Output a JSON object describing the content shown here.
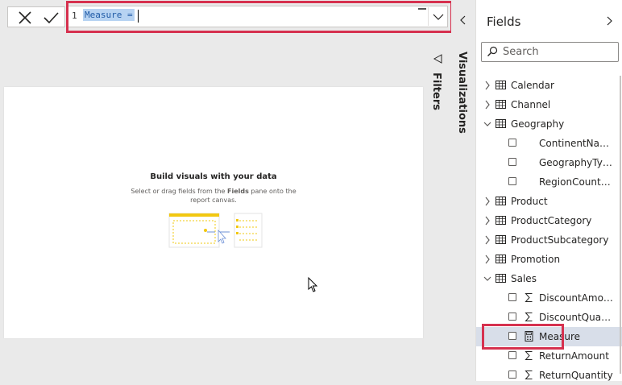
{
  "formula_bar": {
    "line_number": "1",
    "expression": "Measure = "
  },
  "canvas": {
    "empty_title": "Build visuals with your data",
    "empty_subtitle_before": "Select or drag fields from the ",
    "empty_subtitle_bold": "Fields",
    "empty_subtitle_after": " pane onto the report canvas."
  },
  "panes": {
    "filters_label": "Filters",
    "visualizations_label": "Visualizations",
    "fields_title": "Fields"
  },
  "search": {
    "placeholder": "Search"
  },
  "fields": [
    {
      "type": "table",
      "label": "Calendar",
      "expanded": false
    },
    {
      "type": "table",
      "label": "Channel",
      "expanded": false
    },
    {
      "type": "table",
      "label": "Geography",
      "expanded": true
    },
    {
      "type": "field",
      "label": "ContinentName",
      "icon": "none"
    },
    {
      "type": "field",
      "label": "GeographyType",
      "icon": "none"
    },
    {
      "type": "field",
      "label": "RegionCountry...",
      "icon": "none"
    },
    {
      "type": "table",
      "label": "Product",
      "expanded": false
    },
    {
      "type": "table",
      "label": "ProductCategory",
      "expanded": false
    },
    {
      "type": "table",
      "label": "ProductSubcategory",
      "expanded": false
    },
    {
      "type": "table",
      "label": "Promotion",
      "expanded": false
    },
    {
      "type": "table",
      "label": "Sales",
      "expanded": true
    },
    {
      "type": "field",
      "label": "DiscountAmount",
      "icon": "sigma-icon"
    },
    {
      "type": "field",
      "label": "DiscountQuant...",
      "icon": "sigma-icon"
    },
    {
      "type": "field",
      "label": "Measure",
      "icon": "calculator-icon",
      "selected": true
    },
    {
      "type": "field",
      "label": "ReturnAmount",
      "icon": "sigma-icon"
    },
    {
      "type": "field",
      "label": "ReturnQuantity",
      "icon": "sigma-icon"
    }
  ],
  "colors": {
    "highlight_border": "#d6314f",
    "selection_bg": "#b7d3f2",
    "accent_yellow": "#f2c811"
  }
}
